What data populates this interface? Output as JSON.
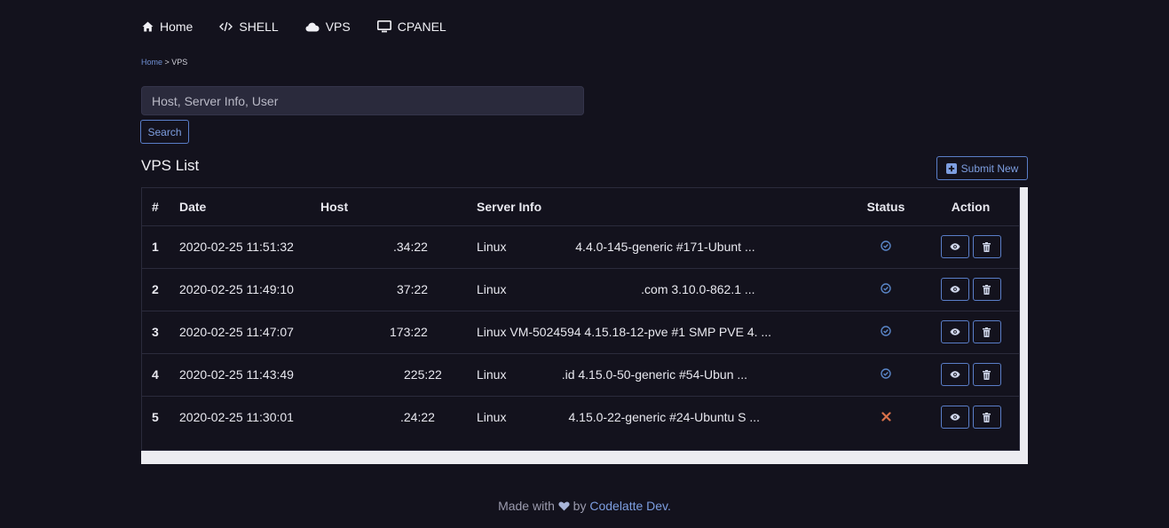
{
  "nav": {
    "items": [
      {
        "label": "Home",
        "icon": "home-icon"
      },
      {
        "label": "SHELL",
        "icon": "code-icon"
      },
      {
        "label": "VPS",
        "icon": "cloud-icon"
      },
      {
        "label": "CPANEL",
        "icon": "monitor-icon"
      }
    ]
  },
  "breadcrumb": {
    "home": "Home",
    "separator": " > ",
    "current": "VPS"
  },
  "search": {
    "placeholder": "Host, Server Info, User",
    "value": "",
    "button": "Search"
  },
  "list": {
    "title": "VPS List",
    "submit_label": "Submit New"
  },
  "table": {
    "headers": {
      "num": "#",
      "date": "Date",
      "host": "Host",
      "info": "Server Info",
      "status": "Status",
      "action": "Action"
    },
    "rows": [
      {
        "num": "1",
        "date": "2020-02-25 11:51:32",
        "host": ".34:22",
        "info": "Linux                    4.4.0-145-generic #171-Ubunt ...",
        "status": "ok"
      },
      {
        "num": "2",
        "date": "2020-02-25 11:49:10",
        "host": "37:22",
        "info": "Linux                                       .com 3.10.0-862.1 ...",
        "status": "ok"
      },
      {
        "num": "3",
        "date": "2020-02-25 11:47:07",
        "host": "173:22",
        "info": "Linux VM-5024594 4.15.18-12-pve #1 SMP PVE 4. ...",
        "status": "ok"
      },
      {
        "num": "4",
        "date": "2020-02-25 11:43:49",
        "host": "225:22",
        "info": "Linux                .id 4.15.0-50-generic #54-Ubun ...",
        "status": "ok"
      },
      {
        "num": "5",
        "date": "2020-02-25 11:30:01",
        "host": ".24:22",
        "info": "Linux                  4.15.0-22-generic #24-Ubuntu S ...",
        "status": "fail"
      }
    ]
  },
  "footer": {
    "prefix": "Made with",
    "by": "by",
    "author": "Codelatte Dev."
  },
  "colors": {
    "accent": "#5a7ec8",
    "status_ok": "#5a86c8",
    "status_fail": "#d9714a",
    "background": "#13121d"
  }
}
